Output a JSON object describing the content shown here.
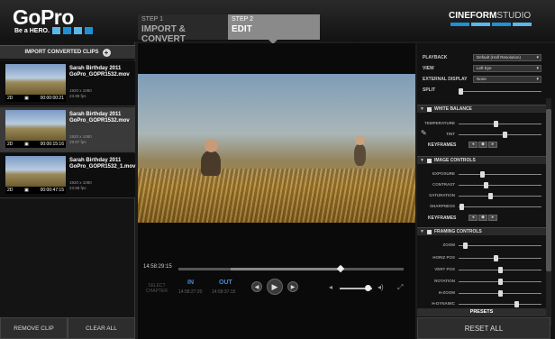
{
  "header": {
    "logo": "GoPro",
    "tagline": "Be a HERO.",
    "step1": {
      "num": "STEP 1",
      "label": "IMPORT & CONVERT"
    },
    "step2": {
      "num": "STEP 2",
      "label": "EDIT"
    },
    "brand": "CINEFORM",
    "brand_suffix": "STUDIO",
    "colors": {
      "blue": "#1e90d6",
      "light_blue": "#58b8ea",
      "active_step": "#8a8a8a"
    }
  },
  "left_panel": {
    "import_label": "IMPORT CONVERTED CLIPS",
    "clips": [
      {
        "name": "Sarah Birthday 2011 GoPro_GOPR1532.mov",
        "mode": "2D",
        "duration": "00:00:00:21",
        "resolution": "1920 x 1080",
        "fps": "23.98 fps",
        "selected": false
      },
      {
        "name": "Sarah Birthday 2011 GoPro_GOPR1532.mov",
        "mode": "2D",
        "duration": "00:00:15:16",
        "resolution": "1920 x 1080",
        "fps": "29.97 fps",
        "selected": true
      },
      {
        "name": "Sarah Birthday 2011 GoPro_GOPR1532_1.mov",
        "mode": "2D",
        "duration": "00:00:47:15",
        "resolution": "1920 x 1080",
        "fps": "23.98 fps",
        "selected": false
      }
    ],
    "remove_label": "REMOVE CLIP",
    "clear_label": "CLEAR ALL"
  },
  "player": {
    "timecode": "14:58:29:15",
    "progress": 0.72,
    "visible_segment_start": 0.23,
    "visible_segment_end": 0.72,
    "select_label": "SELECT CHAPTER",
    "in_label": "IN",
    "out_label": "OUT",
    "in_value": "14:58:27:20",
    "out_value": "14:58:37:15",
    "volume": 0.85
  },
  "right_panel": {
    "playback": {
      "label": "PLAYBACK",
      "value": "Default (Half Resolution)"
    },
    "view": {
      "label": "VIEW",
      "value": "Left Eye"
    },
    "external": {
      "label": "EXTERNAL DISPLAY",
      "value": "None"
    },
    "split": {
      "label": "SPLIT",
      "value": 0.0
    },
    "white_balance": {
      "title": "WHITE BALANCE",
      "temperature": {
        "label": "TEMPERATURE",
        "value": 0.45
      },
      "tint": {
        "label": "TINT",
        "value": 0.55
      },
      "keyframes_label": "KEYFRAMES"
    },
    "image_controls": {
      "title": "IMAGE CONTROLS",
      "exposure": {
        "label": "EXPOSURE",
        "value": 0.28
      },
      "contrast": {
        "label": "CONTRAST",
        "value": 0.33
      },
      "saturation": {
        "label": "SATURATION",
        "value": 0.38
      },
      "sharpness": {
        "label": "SHARPNESS",
        "value": 0.03
      },
      "keyframes_label": "KEYFRAMES"
    },
    "framing": {
      "title": "FRAMING CONTROLS",
      "zoom": {
        "label": "ZOOM",
        "value": 0.08
      },
      "horiz": {
        "label": "HORIZ POS",
        "value": 0.45
      },
      "vert": {
        "label": "VERT POS",
        "value": 0.5
      },
      "rotation": {
        "label": "ROTATION",
        "value": 0.5
      },
      "hzoom": {
        "label": "H-ZOOM",
        "value": 0.5
      },
      "hdynamic": {
        "label": "H-DYNAMIC",
        "value": 0.7
      }
    },
    "presets_label": "PRESETS",
    "reset_label": "RESET ALL"
  }
}
